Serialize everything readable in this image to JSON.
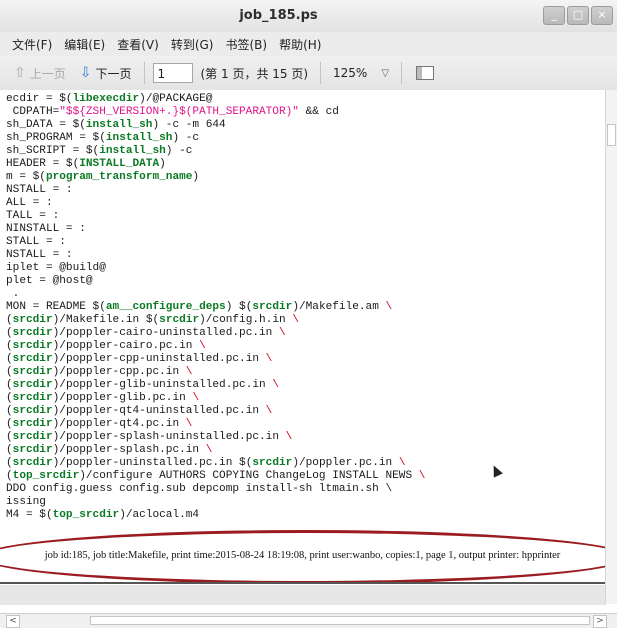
{
  "window": {
    "title": "job_185.ps",
    "buttons": [
      "_",
      "□",
      "×"
    ]
  },
  "menubar": {
    "items": [
      "文件(F)",
      "编辑(E)",
      "查看(V)",
      "转到(G)",
      "书签(B)",
      "帮助(H)"
    ]
  },
  "toolbar": {
    "prev_label": "上一页",
    "next_label": "下一页",
    "page_value": "1",
    "page_info": "(第 1 页，共 15 页)",
    "zoom": "125%"
  },
  "document": {
    "code_lines": [
      [
        [
          "t",
          "ecdir = $("
        ],
        [
          "v",
          "libexecdir"
        ],
        [
          "t",
          ")/@PACKAGE@"
        ]
      ],
      [
        [
          "t",
          " CDPATH="
        ],
        [
          "s",
          "\"$${ZSH_VERSION+.}$(PATH_SEPARATOR)\""
        ],
        [
          "t",
          " && cd"
        ]
      ],
      [
        [
          "t",
          "sh_DATA = $("
        ],
        [
          "v",
          "install_sh"
        ],
        [
          "t",
          ") -c -m 644"
        ]
      ],
      [
        [
          "t",
          "sh_PROGRAM = $("
        ],
        [
          "v",
          "install_sh"
        ],
        [
          "t",
          ") -c"
        ]
      ],
      [
        [
          "t",
          "sh_SCRIPT = $("
        ],
        [
          "v",
          "install_sh"
        ],
        [
          "t",
          ") -c"
        ]
      ],
      [
        [
          "t",
          "HEADER = $("
        ],
        [
          "v",
          "INSTALL_DATA"
        ],
        [
          "t",
          ")"
        ]
      ],
      [
        [
          "t",
          "m = $("
        ],
        [
          "v",
          "program_transform_name"
        ],
        [
          "t",
          ")"
        ]
      ],
      [
        [
          "t",
          "NSTALL = :"
        ]
      ],
      [
        [
          "t",
          "ALL = :"
        ]
      ],
      [
        [
          "t",
          "TALL = :"
        ]
      ],
      [
        [
          "t",
          "NINSTALL = :"
        ]
      ],
      [
        [
          "t",
          "STALL = :"
        ]
      ],
      [
        [
          "t",
          "NSTALL = :"
        ]
      ],
      [
        [
          "t",
          "iplet = @build@"
        ]
      ],
      [
        [
          "t",
          "plet = @host@"
        ]
      ],
      [
        [
          "t",
          " ."
        ]
      ],
      [
        [
          "t",
          "MON = README $("
        ],
        [
          "v",
          "am__configure_deps"
        ],
        [
          "t",
          ") $("
        ],
        [
          "v",
          "srcdir"
        ],
        [
          "t",
          ")/Makefile.am "
        ],
        [
          "bs",
          "\\"
        ]
      ],
      [
        [
          "t",
          "("
        ],
        [
          "v",
          "srcdir"
        ],
        [
          "t",
          ")/Makefile.in $("
        ],
        [
          "v",
          "srcdir"
        ],
        [
          "t",
          ")/config.h.in "
        ],
        [
          "bs",
          "\\"
        ]
      ],
      [
        [
          "t",
          "("
        ],
        [
          "v",
          "srcdir"
        ],
        [
          "t",
          ")/poppler-cairo-uninstalled.pc.in "
        ],
        [
          "bs",
          "\\"
        ]
      ],
      [
        [
          "t",
          "("
        ],
        [
          "v",
          "srcdir"
        ],
        [
          "t",
          ")/poppler-cairo.pc.in "
        ],
        [
          "bs",
          "\\"
        ]
      ],
      [
        [
          "t",
          "("
        ],
        [
          "v",
          "srcdir"
        ],
        [
          "t",
          ")/poppler-cpp-uninstalled.pc.in "
        ],
        [
          "bs",
          "\\"
        ]
      ],
      [
        [
          "t",
          "("
        ],
        [
          "v",
          "srcdir"
        ],
        [
          "t",
          ")/poppler-cpp.pc.in "
        ],
        [
          "bs",
          "\\"
        ]
      ],
      [
        [
          "t",
          "("
        ],
        [
          "v",
          "srcdir"
        ],
        [
          "t",
          ")/poppler-glib-uninstalled.pc.in "
        ],
        [
          "bs",
          "\\"
        ]
      ],
      [
        [
          "t",
          "("
        ],
        [
          "v",
          "srcdir"
        ],
        [
          "t",
          ")/poppler-glib.pc.in "
        ],
        [
          "bs",
          "\\"
        ]
      ],
      [
        [
          "t",
          "("
        ],
        [
          "v",
          "srcdir"
        ],
        [
          "t",
          ")/poppler-qt4-uninstalled.pc.in "
        ],
        [
          "bs",
          "\\"
        ]
      ],
      [
        [
          "t",
          "("
        ],
        [
          "v",
          "srcdir"
        ],
        [
          "t",
          ")/poppler-qt4.pc.in "
        ],
        [
          "bs",
          "\\"
        ]
      ],
      [
        [
          "t",
          "("
        ],
        [
          "v",
          "srcdir"
        ],
        [
          "t",
          ")/poppler-splash-uninstalled.pc.in "
        ],
        [
          "bs",
          "\\"
        ]
      ],
      [
        [
          "t",
          "("
        ],
        [
          "v",
          "srcdir"
        ],
        [
          "t",
          ")/poppler-splash.pc.in "
        ],
        [
          "bs",
          "\\"
        ]
      ],
      [
        [
          "t",
          "("
        ],
        [
          "v",
          "srcdir"
        ],
        [
          "t",
          ")/poppler-uninstalled.pc.in $("
        ],
        [
          "v",
          "srcdir"
        ],
        [
          "t",
          ")/poppler.pc.in "
        ],
        [
          "bs",
          "\\"
        ]
      ],
      [
        [
          "t",
          "("
        ],
        [
          "v",
          "top_srcdir"
        ],
        [
          "t",
          ")/configure AUTHORS COPYING ChangeLog INSTALL NEWS "
        ],
        [
          "bs",
          "\\"
        ]
      ],
      [
        [
          "t",
          "DDO config.guess config.sub depcomp install-sh ltmain.sh \\"
        ]
      ],
      [
        [
          "t",
          "issing"
        ]
      ],
      [
        [
          "t",
          "M4 = $("
        ],
        [
          "v",
          "top_srcdir"
        ],
        [
          "t",
          ")/aclocal.m4"
        ]
      ]
    ],
    "footer": "job id:185, job title:Makefile, print time:2015-08-24 18:19:08, print user:wanbo, copies:1, page 1, output printer: hpprinter"
  },
  "colors": {
    "accent_ellipse": "#9b1c20",
    "variable": "#0b7a24",
    "string": "#e0148a"
  }
}
